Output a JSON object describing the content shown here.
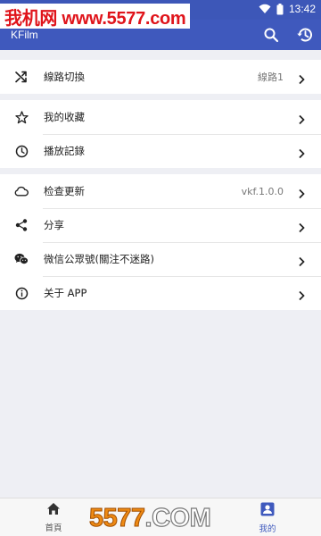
{
  "status_bar": {
    "time": "13:42",
    "watermark_text": "我机网 www.5577.com"
  },
  "app_bar": {
    "title": "KFilm",
    "icons": [
      "search-icon",
      "history-icon"
    ]
  },
  "groups": [
    {
      "items": [
        {
          "icon": "shuffle-icon",
          "label": "線路切換",
          "value": "線路1"
        }
      ]
    },
    {
      "items": [
        {
          "icon": "star-icon",
          "label": "我的收藏",
          "value": ""
        },
        {
          "icon": "clock-icon",
          "label": "播放記錄",
          "value": ""
        }
      ]
    },
    {
      "items": [
        {
          "icon": "cloud-icon",
          "label": "检查更新",
          "value": "vkf.1.0.0"
        },
        {
          "icon": "share-icon",
          "label": "分享",
          "value": ""
        },
        {
          "icon": "wechat-icon",
          "label": "微信公眾號(關注不迷路)",
          "value": ""
        },
        {
          "icon": "info-icon",
          "label": "关于 APP",
          "value": ""
        }
      ]
    }
  ],
  "bottom_nav": {
    "items": [
      {
        "icon": "home-icon",
        "label": "首頁",
        "active": false
      },
      {
        "icon": "profile-icon",
        "label": "我的",
        "active": true
      }
    ],
    "watermark_text": "5577.COM"
  },
  "colors": {
    "primary": "#3f59bd",
    "background": "#eeeff4",
    "watermark_red": "#e0141b",
    "watermark_orange": "#ee8a14"
  }
}
